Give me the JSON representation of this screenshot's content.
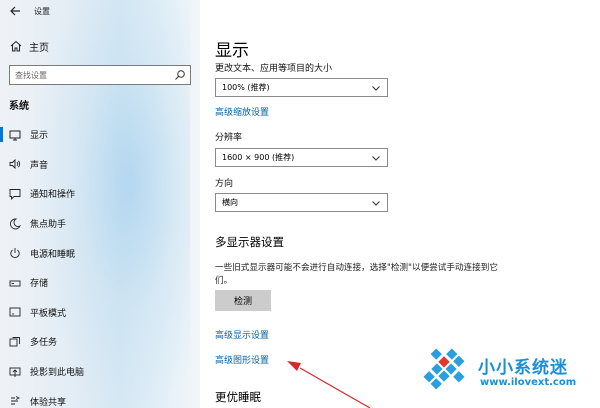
{
  "window": {
    "title": "设置"
  },
  "sidebar": {
    "home_label": "主页",
    "search_placeholder": "查找设置",
    "section_label": "系统",
    "items": [
      {
        "label": "显示",
        "icon": "monitor-icon",
        "selected": true
      },
      {
        "label": "声音",
        "icon": "speaker-icon",
        "selected": false
      },
      {
        "label": "通知和操作",
        "icon": "notification-icon",
        "selected": false
      },
      {
        "label": "焦点助手",
        "icon": "moon-icon",
        "selected": false
      },
      {
        "label": "电源和睡眠",
        "icon": "power-icon",
        "selected": false
      },
      {
        "label": "存储",
        "icon": "storage-icon",
        "selected": false
      },
      {
        "label": "平板模式",
        "icon": "tablet-icon",
        "selected": false
      },
      {
        "label": "多任务",
        "icon": "multitask-icon",
        "selected": false
      },
      {
        "label": "投影到此电脑",
        "icon": "project-icon",
        "selected": false
      },
      {
        "label": "体验共享",
        "icon": "share-icon",
        "selected": false
      }
    ]
  },
  "main": {
    "title": "显示",
    "scale_label": "更改文本、应用等项目的大小",
    "scale_value": "100% (推荐)",
    "advanced_scaling_link": "高级缩放设置",
    "resolution_label": "分辨率",
    "resolution_value": "1600 × 900 (推荐)",
    "orientation_label": "方向",
    "orientation_value": "横向",
    "multi_display_heading": "多显示器设置",
    "multi_display_desc": "一些旧式显示器可能不会进行自动连接，选择\"检测\"以便尝试手动连接到它们。",
    "detect_button": "检测",
    "advanced_display_link": "高级显示设置",
    "graphics_settings_link": "高级图形设置",
    "sleep_heading": "更优睡眠"
  },
  "watermark": {
    "brand": "小小系统迷",
    "url": "www.ilovext.com"
  },
  "colors": {
    "accent": "#0078d7",
    "link": "#0063b1",
    "annotation_arrow": "#d42a2a",
    "watermark": "#1a8fd8"
  }
}
